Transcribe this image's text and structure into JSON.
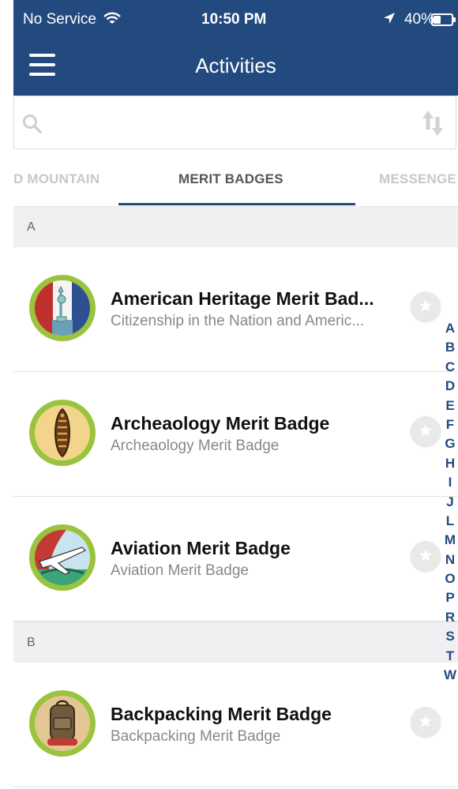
{
  "status_bar": {
    "carrier": "No Service",
    "time": "10:50 PM",
    "battery": "40%"
  },
  "header": {
    "title": "Activities"
  },
  "search": {
    "placeholder": ""
  },
  "tabs": [
    {
      "label": "D MOUNTAIN",
      "active": false
    },
    {
      "label": "MERIT BADGES",
      "active": true
    },
    {
      "label": "MESSENGE",
      "active": false
    }
  ],
  "sections": [
    {
      "letter": "A"
    },
    {
      "letter": "B"
    }
  ],
  "items": [
    {
      "title": "American Heritage Merit Bad...",
      "subtitle": "Citizenship in the Nation and Americ...",
      "icon": "american-heritage-badge-icon"
    },
    {
      "title": "Archeaology Merit Badge",
      "subtitle": "Archeaology Merit Badge",
      "icon": "archeaology-badge-icon"
    },
    {
      "title": "Aviation Merit Badge",
      "subtitle": "Aviation Merit Badge",
      "icon": "aviation-badge-icon"
    },
    {
      "title": "Backpacking Merit Badge",
      "subtitle": "Backpacking Merit Badge",
      "icon": "backpacking-badge-icon"
    }
  ],
  "index_letters": [
    "A",
    "B",
    "C",
    "D",
    "E",
    "F",
    "G",
    "H",
    "I",
    "J",
    "L",
    "M",
    "N",
    "O",
    "P",
    "R",
    "S",
    "T",
    "W"
  ],
  "colors": {
    "header_bg": "#234a7f",
    "badge_border": "#9ac33e",
    "index_text": "#234a7f"
  }
}
